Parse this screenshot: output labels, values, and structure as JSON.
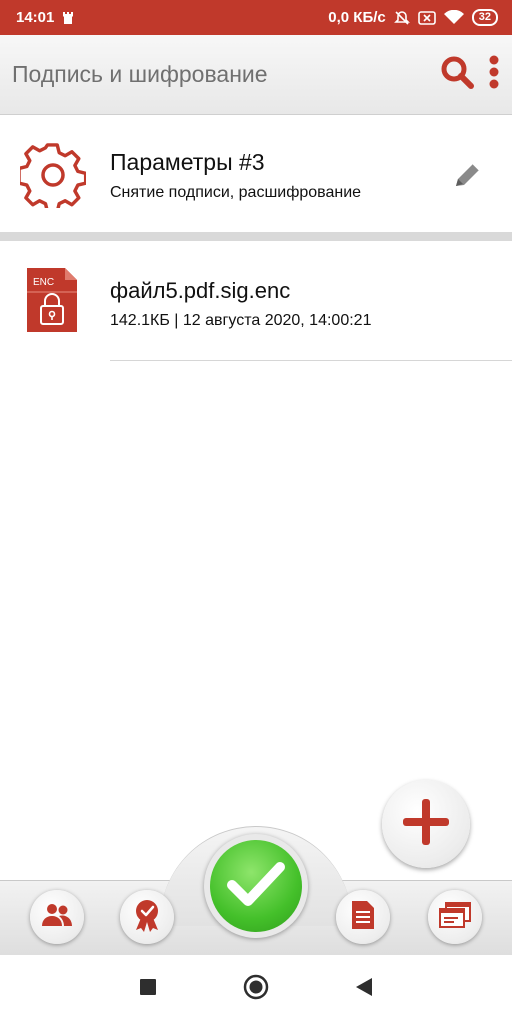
{
  "status_bar": {
    "time": "14:01",
    "network_speed": "0,0 КБ/с",
    "battery_level": "32",
    "icons": [
      "castle-icon",
      "alarm-off-icon",
      "sim-off-icon",
      "wifi-icon",
      "battery-icon"
    ]
  },
  "app_bar": {
    "title": "Подпись и шифрование",
    "icons": [
      "search-icon",
      "more-vert-icon"
    ]
  },
  "params": {
    "title": "Параметры #3",
    "subtitle": "Снятие подписи, расшифрование",
    "icons": [
      "gear-icon",
      "pencil-icon"
    ]
  },
  "files": [
    {
      "name": "файл5.pdf.sig.enc",
      "meta": "142.1КБ | 12 августа 2020, 14:00:21",
      "icon_badge": "ENC"
    }
  ],
  "toolbar": {
    "buttons": [
      "contacts-icon",
      "certificate-icon",
      "checkmark-icon",
      "document-icon",
      "windows-icon"
    ]
  },
  "fab": {
    "icon": "plus-icon"
  },
  "nav_bar": {
    "buttons": [
      "recents-icon",
      "home-icon",
      "back-icon"
    ]
  },
  "colors": {
    "accent": "#c0392b",
    "confirm": "#44c02a"
  }
}
